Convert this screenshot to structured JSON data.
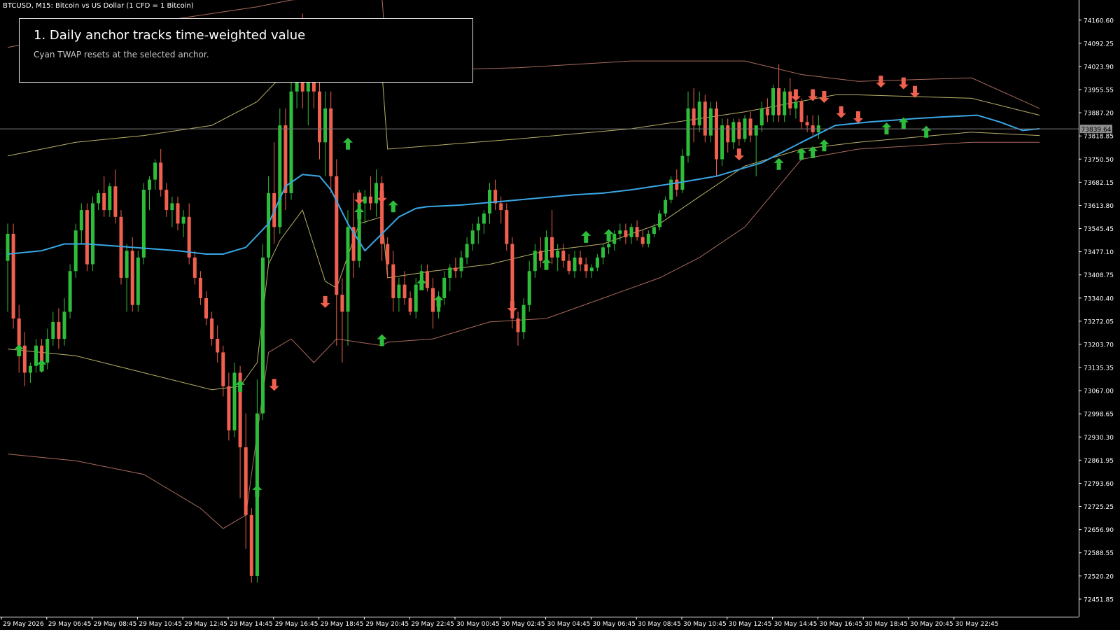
{
  "chart_header": "BTCUSD, M15:  Bitcoin vs US Dollar (1 CFD = 1 Bitcoin)",
  "annotation": {
    "title": "1. Daily anchor tracks time-weighted value",
    "subtitle": "Cyan TWAP resets at the selected anchor."
  },
  "colors": {
    "background": "#000000",
    "bull_candle": "#2ebd3a",
    "bear_candle": "#f0604f",
    "twap_line": "#3aa7e4",
    "inner_band": "#d9cf7a",
    "outer_band": "#c77e6e",
    "current_price_line": "#7a7a7a",
    "axis": "#ffffff",
    "tick_text": "#ffffff",
    "price_label_bg": "#8e8e8e",
    "price_label_text": "#000000"
  },
  "chart_data": {
    "type": "candlestick",
    "symbol": "BTCUSD",
    "timeframe": "M15",
    "ylim": [
      72400,
      74220
    ],
    "y_ticks": [
      74160.6,
      74092.25,
      74023.9,
      73955.55,
      73887.2,
      73818.85,
      73750.5,
      73682.15,
      73613.8,
      73545.45,
      73477.1,
      73408.75,
      73340.4,
      73272.05,
      73203.7,
      73135.35,
      73067.0,
      72998.65,
      72930.3,
      72861.95,
      72793.6,
      72725.25,
      72656.9,
      72588.55,
      72520.2,
      72451.85
    ],
    "x_ticks": [
      "29 May 2026",
      "29 May 06:45",
      "29 May 08:45",
      "29 May 10:45",
      "29 May 12:45",
      "29 May 14:45",
      "29 May 16:45",
      "29 May 18:45",
      "29 May 20:45",
      "29 May 22:45",
      "30 May 00:45",
      "30 May 02:45",
      "30 May 04:45",
      "30 May 06:45",
      "30 May 08:45",
      "30 May 10:45",
      "30 May 12:45",
      "30 May 14:45",
      "30 May 16:45",
      "30 May 18:45",
      "30 May 20:45",
      "30 May 22:45"
    ],
    "bars_per_tick": 8,
    "current_price": 73839.64,
    "current_price_label": "73839.64",
    "candles": [
      [
        73450,
        73560,
        73300,
        73530
      ],
      [
        73530,
        73560,
        73250,
        73280
      ],
      [
        73280,
        73320,
        73120,
        73200
      ],
      [
        73200,
        73240,
        73080,
        73120
      ],
      [
        73120,
        73150,
        73090,
        73140
      ],
      [
        73140,
        73220,
        73120,
        73200
      ],
      [
        73200,
        73220,
        73120,
        73150
      ],
      [
        73150,
        73250,
        73130,
        73220
      ],
      [
        73220,
        73300,
        73200,
        73270
      ],
      [
        73270,
        73310,
        73190,
        73220
      ],
      [
        73220,
        73340,
        73200,
        73300
      ],
      [
        73300,
        73440,
        73280,
        73420
      ],
      [
        73420,
        73560,
        73400,
        73540
      ],
      [
        73540,
        73620,
        73500,
        73600
      ],
      [
        73600,
        73620,
        73420,
        73440
      ],
      [
        73440,
        73640,
        73420,
        73620
      ],
      [
        73620,
        73660,
        73600,
        73650
      ],
      [
        73650,
        73700,
        73580,
        73600
      ],
      [
        73600,
        73680,
        73580,
        73670
      ],
      [
        73670,
        73720,
        73560,
        73580
      ],
      [
        73580,
        73600,
        73380,
        73400
      ],
      [
        73400,
        73500,
        73300,
        73480
      ],
      [
        73480,
        73520,
        73300,
        73320
      ],
      [
        73320,
        73480,
        73300,
        73460
      ],
      [
        73460,
        73680,
        73440,
        73660
      ],
      [
        73660,
        73700,
        73600,
        73690
      ],
      [
        73690,
        73750,
        73660,
        73740
      ],
      [
        73740,
        73780,
        73640,
        73660
      ],
      [
        73660,
        73680,
        73580,
        73600
      ],
      [
        73600,
        73640,
        73550,
        73620
      ],
      [
        73620,
        73640,
        73540,
        73560
      ],
      [
        73560,
        73600,
        73520,
        73580
      ],
      [
        73580,
        73620,
        73440,
        73460
      ],
      [
        73460,
        73480,
        73380,
        73400
      ],
      [
        73400,
        73420,
        73320,
        73340
      ],
      [
        73340,
        73360,
        73260,
        73280
      ],
      [
        73280,
        73300,
        73200,
        73220
      ],
      [
        73220,
        73260,
        73150,
        73180
      ],
      [
        73180,
        73200,
        73050,
        73080
      ],
      [
        73080,
        73120,
        72920,
        72950
      ],
      [
        72950,
        73150,
        72930,
        73120
      ],
      [
        73120,
        73140,
        72750,
        72900
      ],
      [
        72900,
        73000,
        72600,
        72700
      ],
      [
        72700,
        72720,
        72500,
        72520
      ],
      [
        72520,
        73100,
        72500,
        73000
      ],
      [
        73000,
        73500,
        72980,
        73460
      ],
      [
        73460,
        73700,
        73440,
        73650
      ],
      [
        73650,
        73800,
        73500,
        73550
      ],
      [
        73550,
        73900,
        73530,
        73850
      ],
      [
        73850,
        73900,
        73600,
        73650
      ],
      [
        73650,
        74000,
        73630,
        73950
      ],
      [
        73950,
        74150,
        73900,
        74100
      ],
      [
        74100,
        74180,
        73900,
        73950
      ],
      [
        73950,
        74020,
        73850,
        74000
      ],
      [
        74000,
        74150,
        73900,
        73950
      ],
      [
        73950,
        74000,
        73750,
        73800
      ],
      [
        73800,
        73950,
        73700,
        73900
      ],
      [
        73900,
        73950,
        73650,
        73700
      ],
      [
        73700,
        73750,
        73200,
        73350
      ],
      [
        73350,
        73400,
        73150,
        73300
      ],
      [
        73300,
        73600,
        73200,
        73550
      ],
      [
        73550,
        73650,
        73400,
        73450
      ],
      [
        73450,
        73660,
        73430,
        73620
      ],
      [
        73620,
        73660,
        73560,
        73640
      ],
      [
        73640,
        73700,
        73600,
        73620
      ],
      [
        73620,
        73720,
        73580,
        73680
      ],
      [
        73680,
        73700,
        73450,
        73500
      ],
      [
        73500,
        73520,
        73400,
        73440
      ],
      [
        73440,
        73480,
        73300,
        73340
      ],
      [
        73340,
        73400,
        73300,
        73380
      ],
      [
        73380,
        73420,
        73320,
        73340
      ],
      [
        73340,
        73360,
        73290,
        73300
      ],
      [
        73300,
        73400,
        73280,
        73380
      ],
      [
        73380,
        73440,
        73370,
        73420
      ],
      [
        73420,
        73440,
        73360,
        73370
      ],
      [
        73370,
        73400,
        73250,
        73300
      ],
      [
        73300,
        73360,
        73280,
        73340
      ],
      [
        73340,
        73420,
        73320,
        73400
      ],
      [
        73400,
        73440,
        73360,
        73430
      ],
      [
        73430,
        73460,
        73400,
        73420
      ],
      [
        73420,
        73480,
        73400,
        73460
      ],
      [
        73460,
        73520,
        73440,
        73500
      ],
      [
        73500,
        73560,
        73480,
        73540
      ],
      [
        73540,
        73580,
        73500,
        73560
      ],
      [
        73560,
        73600,
        73530,
        73590
      ],
      [
        73590,
        73680,
        73560,
        73660
      ],
      [
        73660,
        73690,
        73600,
        73620
      ],
      [
        73620,
        73640,
        73560,
        73600
      ],
      [
        73600,
        73620,
        73480,
        73500
      ],
      [
        73500,
        73520,
        73250,
        73280
      ],
      [
        73280,
        73300,
        73200,
        73240
      ],
      [
        73240,
        73340,
        73220,
        73320
      ],
      [
        73320,
        73450,
        73300,
        73420
      ],
      [
        73420,
        73500,
        73400,
        73480
      ],
      [
        73480,
        73520,
        73430,
        73450
      ],
      [
        73450,
        73540,
        73440,
        73520
      ],
      [
        73520,
        73600,
        73440,
        73460
      ],
      [
        73460,
        73500,
        73420,
        73480
      ],
      [
        73480,
        73500,
        73430,
        73450
      ],
      [
        73450,
        73470,
        73410,
        73420
      ],
      [
        73420,
        73480,
        73400,
        73460
      ],
      [
        73460,
        73480,
        73420,
        73440
      ],
      [
        73440,
        73460,
        73400,
        73420
      ],
      [
        73420,
        73440,
        73400,
        73430
      ],
      [
        73430,
        73470,
        73420,
        73460
      ],
      [
        73460,
        73500,
        73440,
        73490
      ],
      [
        73490,
        73520,
        73470,
        73500
      ],
      [
        73500,
        73540,
        73480,
        73530
      ],
      [
        73530,
        73560,
        73510,
        73540
      ],
      [
        73540,
        73560,
        73500,
        73520
      ],
      [
        73520,
        73560,
        73500,
        73550
      ],
      [
        73550,
        73570,
        73510,
        73520
      ],
      [
        73520,
        73540,
        73490,
        73500
      ],
      [
        73500,
        73540,
        73490,
        73530
      ],
      [
        73530,
        73560,
        73520,
        73550
      ],
      [
        73550,
        73600,
        73540,
        73590
      ],
      [
        73590,
        73640,
        73580,
        73630
      ],
      [
        73630,
        73700,
        73620,
        73690
      ],
      [
        73690,
        73720,
        73640,
        73660
      ],
      [
        73660,
        73780,
        73650,
        73760
      ],
      [
        73760,
        73950,
        73740,
        73900
      ],
      [
        73900,
        73960,
        73800,
        73850
      ],
      [
        73850,
        73950,
        73830,
        73920
      ],
      [
        73920,
        73940,
        73800,
        73820
      ],
      [
        73820,
        73920,
        73800,
        73900
      ],
      [
        73900,
        73920,
        73700,
        73750
      ],
      [
        73750,
        73870,
        73730,
        73850
      ],
      [
        73850,
        73870,
        73770,
        73800
      ],
      [
        73800,
        73870,
        73780,
        73860
      ],
      [
        73860,
        73870,
        73790,
        73810
      ],
      [
        73810,
        73880,
        73800,
        73870
      ],
      [
        73870,
        73890,
        73800,
        73820
      ],
      [
        73820,
        73840,
        73700,
        73850
      ],
      [
        73850,
        73920,
        73830,
        73900
      ],
      [
        73900,
        73930,
        73860,
        73880
      ],
      [
        73880,
        73970,
        73860,
        73960
      ],
      [
        73960,
        74030,
        73860,
        73880
      ],
      [
        73880,
        73960,
        73860,
        73950
      ],
      [
        73950,
        73990,
        73880,
        73900
      ],
      [
        73900,
        73940,
        73870,
        73920
      ],
      [
        73920,
        73930,
        73840,
        73860
      ],
      [
        73860,
        73880,
        73830,
        73850
      ],
      [
        73850,
        73880,
        73820,
        73830
      ],
      [
        73830,
        73880,
        73810,
        73850
      ]
    ],
    "twap": [
      [
        0,
        73470
      ],
      [
        6,
        73480
      ],
      [
        10,
        73500
      ],
      [
        14,
        73500
      ],
      [
        18,
        73495
      ],
      [
        22,
        73490
      ],
      [
        26,
        73485
      ],
      [
        30,
        73480
      ],
      [
        35,
        73470
      ],
      [
        38,
        73470
      ],
      [
        42,
        73490
      ],
      [
        46,
        73560
      ],
      [
        49,
        73670
      ],
      [
        52,
        73705
      ],
      [
        55,
        73700
      ],
      [
        57,
        73660
      ],
      [
        60,
        73560
      ],
      [
        63,
        73480
      ],
      [
        66,
        73530
      ],
      [
        69,
        73580
      ],
      [
        72,
        73605
      ],
      [
        74,
        73610
      ],
      [
        80,
        73615
      ],
      [
        90,
        73630
      ],
      [
        100,
        73645
      ],
      [
        105,
        73650
      ],
      [
        110,
        73660
      ],
      [
        118,
        73680
      ],
      [
        125,
        73700
      ],
      [
        133,
        73740
      ],
      [
        140,
        73800
      ],
      [
        146,
        73850
      ],
      [
        152,
        73860
      ],
      [
        160,
        73870
      ],
      [
        165,
        73875
      ],
      [
        171,
        73880
      ],
      [
        175,
        73860
      ],
      [
        179,
        73835
      ],
      [
        182,
        73840
      ]
    ],
    "band_inner_upper": [
      [
        0,
        73760
      ],
      [
        12,
        73800
      ],
      [
        24,
        73820
      ],
      [
        36,
        73850
      ],
      [
        44,
        73920
      ],
      [
        48,
        73990
      ],
      [
        52,
        74010
      ],
      [
        58,
        74010
      ],
      [
        66,
        74010
      ],
      [
        67,
        73780
      ],
      [
        90,
        73810
      ],
      [
        110,
        73840
      ],
      [
        130,
        73890
      ],
      [
        146,
        73940
      ],
      [
        150,
        73940
      ],
      [
        170,
        73930
      ],
      [
        182,
        73880
      ]
    ],
    "band_inner_lower": [
      [
        0,
        73190
      ],
      [
        12,
        73170
      ],
      [
        24,
        73120
      ],
      [
        36,
        73070
      ],
      [
        41,
        73080
      ],
      [
        44,
        73150
      ],
      [
        46,
        73440
      ],
      [
        48,
        73510
      ],
      [
        52,
        73600
      ],
      [
        56,
        73390
      ],
      [
        58,
        73370
      ],
      [
        62,
        73560
      ],
      [
        66,
        73580
      ],
      [
        67,
        73400
      ],
      [
        75,
        73420
      ],
      [
        85,
        73440
      ],
      [
        95,
        73480
      ],
      [
        105,
        73500
      ],
      [
        115,
        73560
      ],
      [
        122,
        73640
      ],
      [
        130,
        73730
      ],
      [
        140,
        73780
      ],
      [
        150,
        73800
      ],
      [
        170,
        73830
      ],
      [
        182,
        73820
      ]
    ],
    "band_outer_upper": [
      [
        0,
        74080
      ],
      [
        12,
        74120
      ],
      [
        24,
        74150
      ],
      [
        36,
        74180
      ],
      [
        44,
        74200
      ],
      [
        50,
        74220
      ],
      [
        58,
        74230
      ],
      [
        66,
        74230
      ],
      [
        67,
        74010
      ],
      [
        90,
        74020
      ],
      [
        110,
        74040
      ],
      [
        130,
        74040
      ],
      [
        140,
        74000
      ],
      [
        150,
        73980
      ],
      [
        170,
        73990
      ],
      [
        182,
        73900
      ]
    ],
    "band_outer_lower": [
      [
        0,
        72880
      ],
      [
        12,
        72860
      ],
      [
        24,
        72820
      ],
      [
        34,
        72720
      ],
      [
        38,
        72660
      ],
      [
        42,
        72700
      ],
      [
        46,
        73180
      ],
      [
        50,
        73220
      ],
      [
        54,
        73150
      ],
      [
        58,
        73220
      ],
      [
        66,
        73200
      ],
      [
        67,
        73210
      ],
      [
        75,
        73220
      ],
      [
        85,
        73270
      ],
      [
        95,
        73280
      ],
      [
        105,
        73340
      ],
      [
        115,
        73400
      ],
      [
        122,
        73460
      ],
      [
        130,
        73550
      ],
      [
        140,
        73750
      ],
      [
        150,
        73780
      ],
      [
        170,
        73800
      ],
      [
        182,
        73800
      ]
    ],
    "buy_signals": [
      [
        2,
        73185
      ],
      [
        6,
        73140
      ],
      [
        41,
        73080
      ],
      [
        44,
        72770
      ],
      [
        60,
        73795
      ],
      [
        62,
        73590
      ],
      [
        66,
        73215
      ],
      [
        68,
        73610
      ],
      [
        73,
        73380
      ],
      [
        76,
        73330
      ],
      [
        95,
        73440
      ],
      [
        102,
        73520
      ],
      [
        106,
        73525
      ],
      [
        136,
        73735
      ],
      [
        140,
        73765
      ],
      [
        142,
        73770
      ],
      [
        144,
        73790
      ],
      [
        155,
        73840
      ],
      [
        158,
        73855
      ],
      [
        162,
        73830
      ]
    ],
    "sell_signals": [
      [
        47,
        73085
      ],
      [
        56,
        73330
      ],
      [
        62,
        73635
      ],
      [
        66,
        73640
      ],
      [
        89,
        73315
      ],
      [
        129,
        73765
      ],
      [
        139,
        73940
      ],
      [
        142,
        73940
      ],
      [
        144,
        73935
      ],
      [
        147,
        73890
      ],
      [
        150,
        73875
      ],
      [
        154,
        73980
      ],
      [
        158,
        73975
      ],
      [
        160,
        73950
      ]
    ]
  }
}
